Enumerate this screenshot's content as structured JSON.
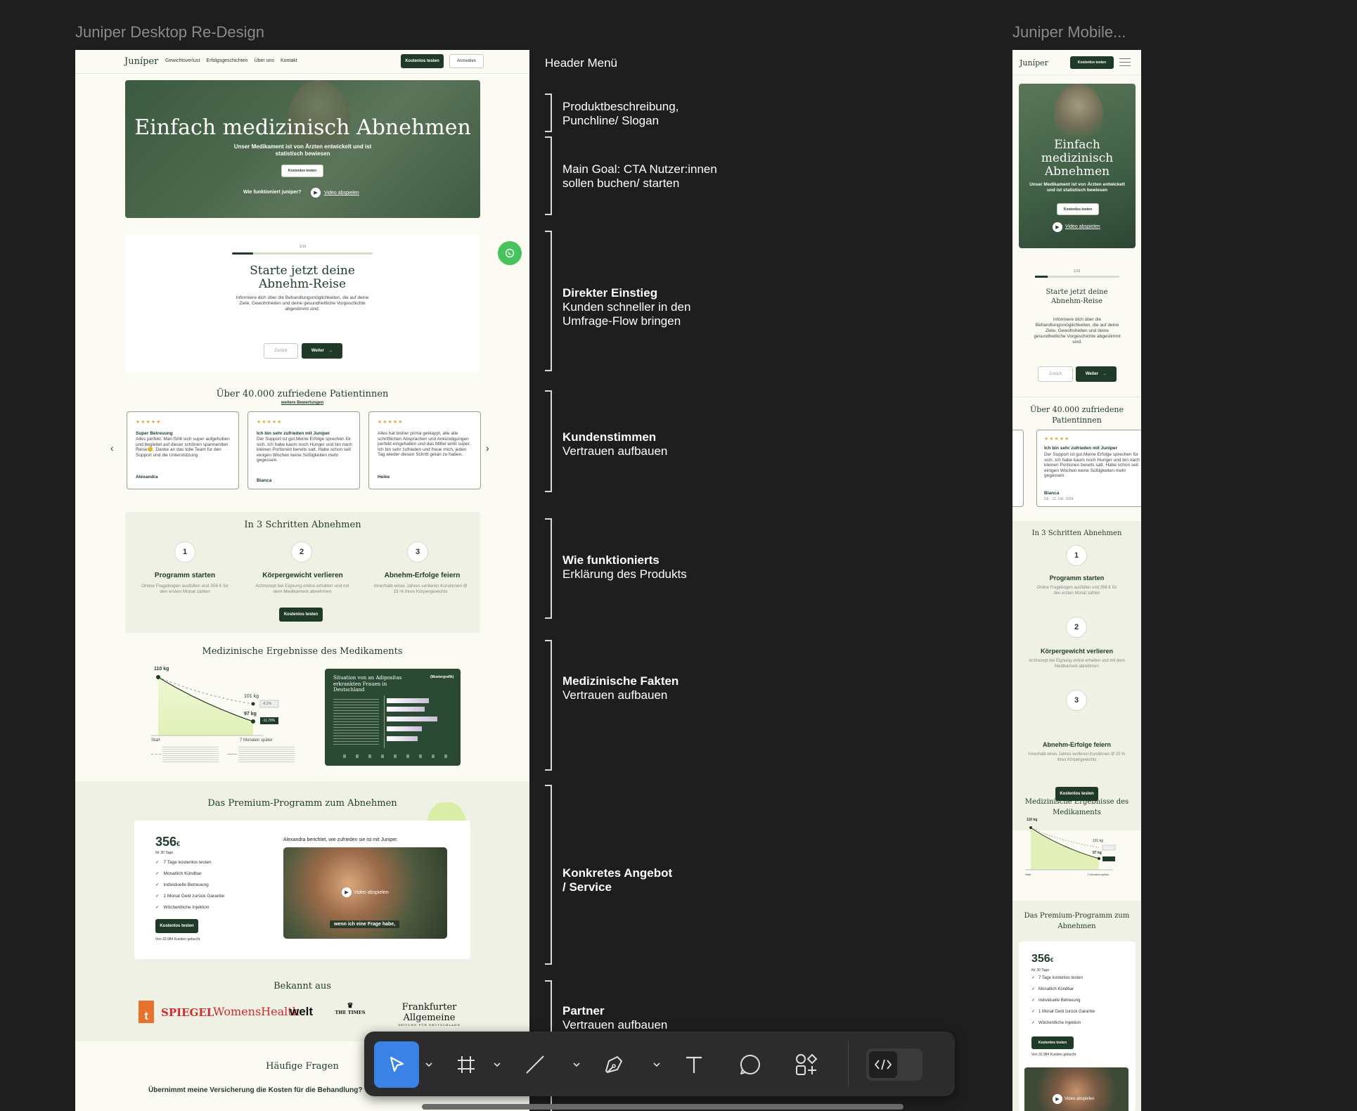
{
  "frames": {
    "desktop_title": "Juniper Desktop Re-Design",
    "mobile_title": "Juniper Mobile..."
  },
  "nav": {
    "logo": "Juníper",
    "links": [
      "Gewichtsverlust",
      "Erfolgsgeschichten",
      "Über uns",
      "Kontakt"
    ],
    "cta": "Kostenlos testen",
    "login": "Anmelden"
  },
  "hero": {
    "title": "Einfach medizinisch Abnehmen",
    "subtitle": "Unser Medikament ist von Ärzten entwickelt und ist statistisch bewiesen",
    "cta": "Kostenlos testen",
    "how": "Wie funktioniert juniper?",
    "video": "Video abspielen"
  },
  "quiz": {
    "step": "1/16",
    "title": "Starte jetzt deine Abnehm-Reise",
    "text": "Informiere dich über die Behandlungsmöglichkeiten, die auf deine Ziele, Gewohnheiten und deine gesundheitliche Vorgeschichte abgestimmt sind.",
    "back": "Zurück",
    "next": "Weiter",
    "progress": 0.15
  },
  "reviews": {
    "title": "Über 40.000 zufriedene Patientinnen",
    "more": "weitere Bewertungen",
    "stars": "★★★★★",
    "prev": "‹",
    "next": "›",
    "items": [
      {
        "headline": "Super Betreuung",
        "text": "Alles perfekt. Man fühlt sich super aufgehoben und begleitet auf dieser schönen spannenden Reise😊. Danke an das tolle Team für den Support und die Unterstützung",
        "author": "Alexandra"
      },
      {
        "headline": "Ich bin sehr zufrieden mit Juniper",
        "text": "Der Support ist gut.Meine Erfolge sprechen für sich. Ich habe kaum noch Hunger und bin nach kleinen Portionen bereits satt. Habe schon seit einigen Wochen keine Süßigkeiten mehr gegessen.",
        "author": "Bianca"
      },
      {
        "headline": "",
        "text": "Alles hat bisher prima geklappt, alle alle schriftlichen Absprachen und Ankündigungen perfekt eingehalten und das Mittel wirkt super. Ich bin sehr zufrieden und freue mich, jeden Tag wieder diesen Schritt getan zu haben.",
        "author": "Heike"
      }
    ]
  },
  "steps": {
    "title": "In 3 Schritten Abnehmen",
    "items": [
      {
        "num": "1",
        "title": "Programm starten",
        "text": "Online Fragebogen ausfüllen und 356 € für den ersten Monat zahlen"
      },
      {
        "num": "2",
        "title": "Körpergewicht verlieren",
        "text": "Arztrezept bei Eignung online erhalten und mit dem Medikament abnehmen"
      },
      {
        "num": "3",
        "title": "Abnehm-Erfolge feiern",
        "text": "Innerhalb eines Jahres verlieren Kundinnen Ø 15 % ihres Körpergewichts"
      }
    ],
    "cta": "Kostenlos testen"
  },
  "results": {
    "title": "Medizinische Ergebnisse des Medikaments",
    "chart_labels": {
      "start_weight": "110 kg",
      "w1": "101 kg",
      "w2": "97 kg",
      "badge1": "-8,2%",
      "badge2": "-11,78%",
      "x_start": "Start",
      "x_end": "7 Monaten später"
    },
    "dark_title": "Situation von an Adipositas erkrankten Frauen in Deutschland",
    "dark_tag": "(Mustergrafik)"
  },
  "premium": {
    "title": "Das Premium-Programm zum Abnehmen",
    "price": "356",
    "currency": "€",
    "period": "für 30 Tage",
    "features": [
      "7 Tage kostenlos testen",
      "Monatlich Kündbar",
      "Individuelle Betreuung",
      "1 Monat Geld zurück Garantie",
      "Wöchentliche Injektion"
    ],
    "cta": "Kostenlos testen",
    "booked": "Von 32.984 Kunden gebucht",
    "video_caption": "Alexandra berichtet, wie zufrieden sie ist mit Juniper.",
    "video_label": "Video abspielen",
    "subtitle": "wenn ich eine Frage habe,"
  },
  "press": {
    "title": "Bekannt aus",
    "logos": [
      "SPIEGEL",
      "WomensHealth",
      "welt",
      "THE TIMES",
      "Frankfurter Allgemeine"
    ],
    "faz_sub": "ZEITUNG FÜR DEUTSCHLAND"
  },
  "faq": {
    "title": "Häufige Fragen",
    "q1": "Übernimmt meine Versicherung die Kosten für die Behandlung?"
  },
  "annotations": [
    {
      "title": "",
      "text": "Header Menü"
    },
    {
      "title": "",
      "text": "Produktbeschreibung, Punchline/ Slogan"
    },
    {
      "title": "",
      "text": "Main Goal: CTA Nutzer:innen sollen buchen/ starten"
    },
    {
      "title": "Direkter Einstieg",
      "text": "Kunden schneller in den Umfrage-Flow bringen"
    },
    {
      "title": "Kundenstimmen",
      "text": "Vertrauen aufbauen"
    },
    {
      "title": "Wie funktionierts",
      "text": "Erklärung des Produkts"
    },
    {
      "title": "Medizinische Fakten",
      "text": "Vertrauen aufbauen"
    },
    {
      "title": "Konkretes Angebot / Service",
      "text": ""
    },
    {
      "title": "Partner",
      "text": "Vertrauen aufbauen"
    }
  ],
  "mobile": {
    "review_date": "DE · 12. Okt. 2024"
  },
  "toolbar": {
    "tools": [
      "move-tool",
      "frame-tool",
      "line-tool",
      "pen-tool",
      "text-tool",
      "comment-tool",
      "components-tool",
      "dev-mode-toggle"
    ]
  },
  "colors": {
    "canvas": "#1e1e1e",
    "page": "#fbfbf3",
    "brand": "#1f3a27",
    "accent_green": "#d6ec9e",
    "star": "#e2a83a",
    "toolbar": "#2c2c2c",
    "selected": "#3b82e6"
  }
}
